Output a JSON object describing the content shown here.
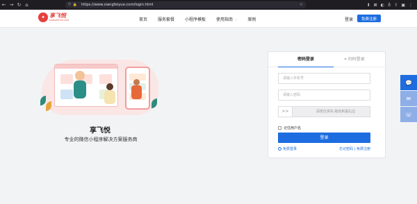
{
  "browser": {
    "back": "←",
    "forward": "→",
    "reload": "↻",
    "home": "⌂",
    "url": "https://www.xiangfeiyue.com/login.html",
    "star": "☆",
    "ext_icons": [
      "⬇",
      "⊠",
      "◐",
      "♁",
      "⇧",
      "▣",
      "⋮"
    ]
  },
  "site": {
    "logo_name": "享飞悦",
    "logo_domain": "XIANGFEIYUE.COM",
    "nav": [
      "首页",
      "服务套餐",
      "小程序模板",
      "使用指南",
      "案例"
    ],
    "nav_dropdown_index": 3,
    "login": "登录",
    "register": "免费注册"
  },
  "hero": {
    "title": "享飞悦",
    "subtitle": "专业的微信小程序解决方案服务商"
  },
  "login_card": {
    "tab_password": "密码登录",
    "tab_qr": "⌗ 扫码登录",
    "phone_placeholder": "请输入手机号",
    "password_placeholder": "请输入密码",
    "slider_handle": ">>",
    "slider_text": "请按住滑块,拖动到最右边",
    "remember": "记住用户名",
    "submit": "登录",
    "free_login": "免费登录",
    "forgot": "忘记密码 | 免费注册"
  },
  "side_buttons": [
    "💬",
    "✉",
    "☏"
  ],
  "colors": {
    "primary": "#1d6de0",
    "brand_red": "#e23a34"
  }
}
